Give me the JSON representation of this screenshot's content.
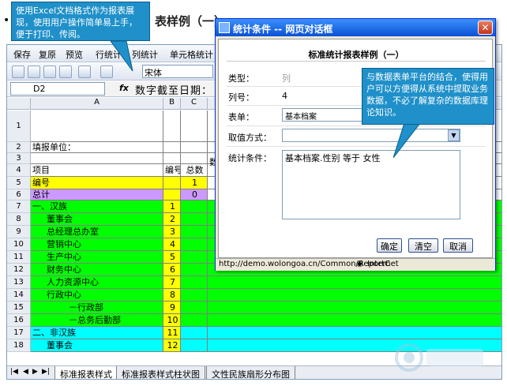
{
  "page_header": {
    "title_tail": "表样例（一）"
  },
  "menubar": {
    "items": [
      "保存",
      "复原",
      "预览",
      "行统计",
      "列统计",
      "单元格统计"
    ]
  },
  "toolbar": {
    "font_name": "宋体"
  },
  "formula_bar": {
    "cell_ref": "D2",
    "fx_label": "fx",
    "value": "数字截至日期："
  },
  "columns": [
    "A",
    "B",
    "C"
  ],
  "rows": [
    {
      "num": "1",
      "a": "",
      "b": "",
      "c": ""
    },
    {
      "num": "2",
      "a": "填报单位：",
      "b": "",
      "c": ""
    },
    {
      "num": "3",
      "a": "",
      "b": "",
      "c": ""
    },
    {
      "num": "4",
      "a": "项目",
      "b": "编号",
      "c": "总数"
    },
    {
      "num": "5",
      "a": "编号",
      "b": "",
      "c": "1"
    },
    {
      "num": "6",
      "a": "总计",
      "b": "",
      "c": "0"
    },
    {
      "num": "7",
      "a": "一、汉族",
      "b": "1",
      "c": ""
    },
    {
      "num": "8",
      "a": "董事会",
      "b": "2",
      "c": ""
    },
    {
      "num": "9",
      "a": "总经理总办室",
      "b": "3",
      "c": ""
    },
    {
      "num": "10",
      "a": "营销中心",
      "b": "4",
      "c": ""
    },
    {
      "num": "11",
      "a": "生产中心",
      "b": "5",
      "c": ""
    },
    {
      "num": "12",
      "a": "财务中心",
      "b": "6",
      "c": ""
    },
    {
      "num": "13",
      "a": "人力资源中心",
      "b": "7",
      "c": ""
    },
    {
      "num": "14",
      "a": "行政中心",
      "b": "8",
      "c": ""
    },
    {
      "num": "15",
      "a": "－行政部",
      "b": "9",
      "c": ""
    },
    {
      "num": "16",
      "a": "－总务后勤部",
      "b": "10",
      "c": ""
    },
    {
      "num": "17",
      "a": "二、非汉族",
      "b": "11",
      "c": ""
    },
    {
      "num": "18",
      "a": "董事会",
      "b": "12",
      "c": ""
    }
  ],
  "partial_header_text": "数",
  "sheet_tabs": [
    "标准报表样式",
    "标准报表样式柱状图",
    "文性民族扇形分布图"
  ],
  "tooltip_left": "使用Excel文档格式作为报表展现，使用用户操作简单易上手，便于打印、传阅。",
  "tooltip_right": "与数据表单平台的结合，使得用户可以方便得从系统中提取业务数据，不必了解复杂的数据库理论知识。",
  "dialog": {
    "title": "统计条件 -- 网页对话框",
    "heading": "标准统计报表样例（一）",
    "fields": [
      {
        "label": "类型：",
        "value": "列"
      },
      {
        "label": "列号：",
        "value": "4"
      },
      {
        "label": "表单：",
        "value": "基本档案"
      },
      {
        "label": "取值方式：",
        "value": ""
      },
      {
        "label": "统计条件：",
        "value": "基本档案.性别  等于  女性"
      }
    ],
    "buttons": {
      "ok": "确定",
      "clear": "清空",
      "cancel": "取消"
    },
    "status_url": "http://demo.wolongoa.cn/Common/ReportC",
    "status_zone": "Internet"
  },
  "colors": {
    "yellow": "#ffff00",
    "violet": "#cc99ff",
    "green": "#00ff00",
    "cyan": "#00ffff",
    "balloon": "#1f90c9"
  }
}
